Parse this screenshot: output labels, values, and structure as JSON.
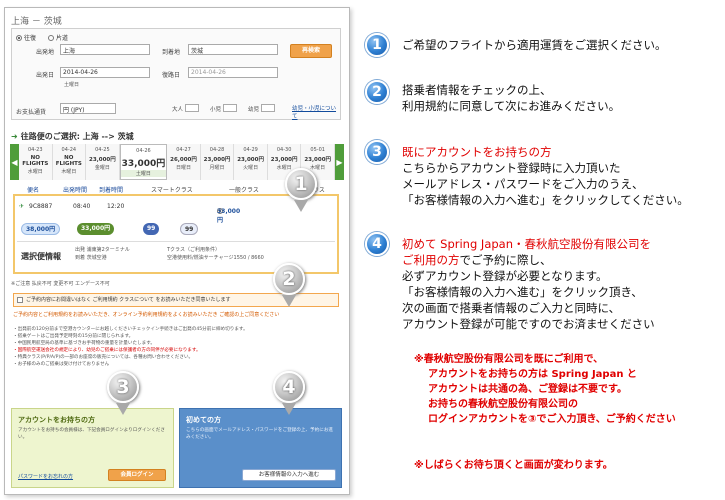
{
  "screenshot": {
    "route": "上海 － 茨城",
    "trip": {
      "roundtrip": "往復",
      "oneway": "片道"
    },
    "fields": {
      "origin_label": "出発地",
      "origin_value": "上海",
      "destination_label": "到着地",
      "destination_value": "茨城",
      "depart_label": "出発日",
      "depart_value": "2014-04-26",
      "depart_day": "土曜日",
      "return_label": "復路日",
      "return_value": "2014-04-26",
      "currency_label": "お支払通貨",
      "currency_value": "円 (JPY)",
      "search_button": "再検索",
      "adult": "大人",
      "child": "小児",
      "infant": "幼児",
      "pax_link": "幼児・小児について"
    },
    "section_title": "往路便のご選択: 上海 --> 茨城",
    "dates": [
      {
        "date": "04-23",
        "price": "NO FLIGHTS",
        "day": "水曜日"
      },
      {
        "date": "04-24",
        "price": "NO FLIGHTS",
        "day": "木曜日"
      },
      {
        "date": "04-25",
        "price": "23,000円",
        "day": "金曜日"
      },
      {
        "date": "04-26",
        "price": "33,000円",
        "day": "土曜日"
      },
      {
        "date": "04-27",
        "price": "26,000円",
        "day": "日曜日"
      },
      {
        "date": "04-28",
        "price": "23,000円",
        "day": "月曜日"
      },
      {
        "date": "04-29",
        "price": "23,000円",
        "day": "火曜日"
      },
      {
        "date": "04-30",
        "price": "23,000円",
        "day": "水曜日"
      },
      {
        "date": "05-01",
        "price": "23,000円",
        "day": "木曜日"
      }
    ],
    "table_head": {
      "flight": "便名",
      "departure": "出発時間",
      "arrival": "到着時間",
      "smart": "スマートクラス",
      "standard": "一般クラス",
      "business": "商務クラス"
    },
    "flight": {
      "number": "9C8887",
      "dep": "08:40",
      "arr": "12:20",
      "price": "33,000円"
    },
    "fares": {
      "pill_a": "38,000円",
      "pill_b": "33,000円",
      "pill_c": "99",
      "pill_d": "99"
    },
    "selected": {
      "title": "選択便情報",
      "l1": "出発 浦東第2ターミナル",
      "l2": "到着 茨城空港",
      "r1": "Tクラス（ご利用条件）",
      "r2": "空港使用料/燃油サーチャージ1550 / 8660"
    },
    "note_line": "※ご注意 払戻不可 変更不可 エンデース不可",
    "agree": "ご予約内容にお間違いはなく  ご利用規約  クラスについて をお読みいただき同意いたします",
    "agree_warn": "ご予約内容とご利用規約をお読みいただき、オンライン予約利用規約をよくお読みいただき ご確認の上ご同意ください",
    "notes": [
      "・出発前の120分前まで空港カウンターにお越しくださいチェックイン手続きはご出発の45分前に締め切ります。",
      "・搭乗ゲートはご出発予定時刻の15分前に閉じられます。",
      "・中国民用航空局の基準に基づきお手荷物の重量を計量いたします。",
      "・国際航空運送会社の規定により、幼児のご搭乗には保護者の方の同伴が必要になります。",
      "・特典クラス(P/P/A/P)の一部のお座席の販売については、各種お問い合わせください。",
      "・お子様のみのご搭乗は受け付けておりません"
    ],
    "member": {
      "title": "アカウントをお持ちの方",
      "desc": "アカウントをお持ちの会員様は、下記会員ログインよりログインください。",
      "link": "パスワードをお忘れの方",
      "button": "会員ログイン"
    },
    "new_user": {
      "title": "初めての方",
      "desc": "こちらの画面でメールアドレス・パスワードをご登録の上、予約にお進みください。",
      "button": "お客様情報の入力へ進む"
    },
    "bubbles": [
      "1",
      "2",
      "3",
      "4"
    ]
  },
  "instructions": {
    "step1": {
      "num": "1",
      "text": "ご希望のフライトから適用運賃をご選択ください。"
    },
    "step2": {
      "num": "2",
      "line1": "搭乗者情報をチェックの上、",
      "line2": "利用規約に同意して次にお進みください。"
    },
    "step3": {
      "num": "3",
      "red": "既にアカウントをお持ちの方",
      "line1": "こちらからアカウント登録時に入力頂いた",
      "line2": "メールアドレス・パスワードをご入力のうえ、",
      "line3": "「お客様情報の入力へ進む」をクリックしてください。"
    },
    "step4": {
      "num": "4",
      "red1": "初めて Spring Japan・春秋航空股份有限公司を",
      "red2": "ご利用の方",
      "red2b": "でご予約に際し、",
      "line3": "必ずアカウント登録が必要となります。",
      "line4": "「お客様情報の入力へ進む」をクリック頂き、",
      "line5": "次の画面で搭乗者情報のご入力と同時に、",
      "line6": "アカウント登録が可能ですのでお済ませください"
    },
    "note1": [
      "※春秋航空股份有限公司を既にご利用で、",
      "アカウントをお持ちの方は Spring Japan と",
      "アカウントは共通の為、ご登録は不要です。",
      "お持ちの春秋航空股份有限公司の",
      "ログインアカウントを③でご入力頂き、ご予約ください"
    ],
    "note2": "※しばらくお待ち頂くと画面が変わります。"
  }
}
